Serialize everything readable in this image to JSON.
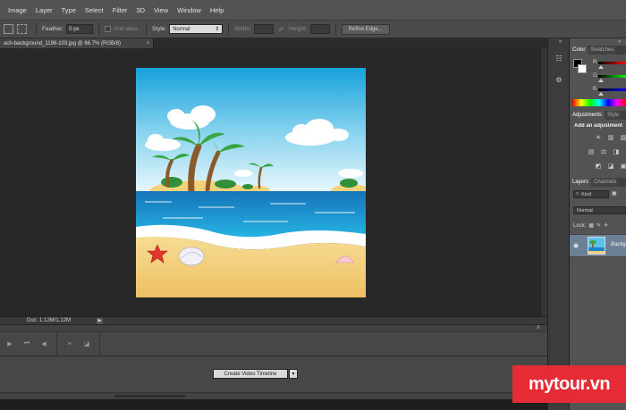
{
  "menu": [
    "Image",
    "Layer",
    "Type",
    "Select",
    "Filter",
    "3D",
    "View",
    "Window",
    "Help"
  ],
  "options": {
    "feather_label": "Feather:",
    "feather_value": "0 px",
    "antialias_label": "Anti-alias",
    "style_label": "Style:",
    "style_value": "Normal",
    "width_label": "Width:",
    "height_label": "Height:",
    "refine_label": "Refine Edge..."
  },
  "document": {
    "tab_title": "ach-background_1196-103.jpg @ 66.7% (RGB/8)",
    "close": "×",
    "status": "Doc: 1.12M/1.12M",
    "status_arrow": "▶"
  },
  "timeline": {
    "create_button": "Create Video Timeline",
    "dropdown": "▾",
    "close": "≡"
  },
  "panels": {
    "color_tab": "Color",
    "swatches_tab": "Swatches",
    "channels": [
      "R",
      "G",
      "B"
    ],
    "adjustments_tab": "Adjustments",
    "styles_tab": "Style",
    "add_adjustment": "Add an adjustment",
    "layers_tab": "Layers",
    "channels_tab": "Channels",
    "kind_label": "Kind",
    "blend_mode": "Normal",
    "lock_label": "Lock:",
    "layer_name": "Backg"
  },
  "icons": {
    "rect_marquee": "rect-marquee-icon",
    "swap": "⇄",
    "collapse": "«",
    "eye": "◉"
  },
  "watermark": "mytour.vn",
  "colors": {
    "sky_top": "#1aa3dc",
    "sea": "#1b86c8",
    "sand": "#f2cf7a",
    "layer_selected": "#6d7f95",
    "watermark": "#e52b36"
  }
}
